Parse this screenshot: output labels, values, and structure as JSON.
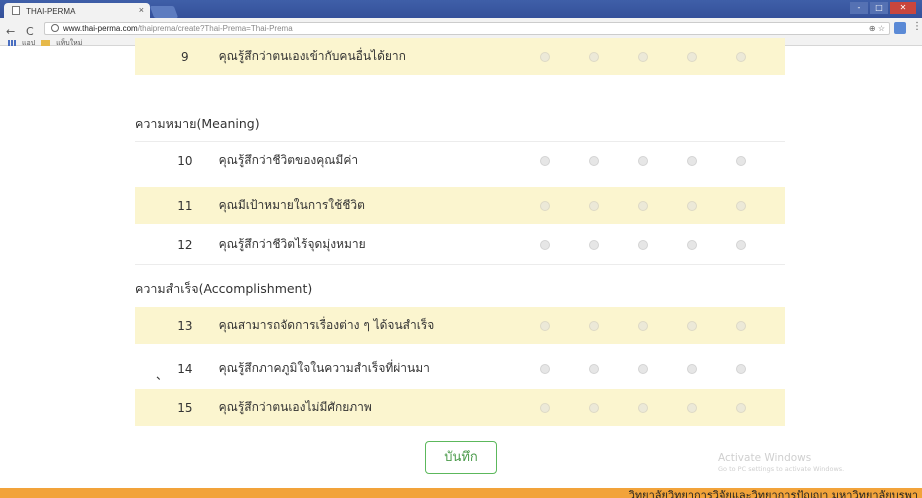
{
  "browser": {
    "tab_title": "THAI-PERMA",
    "tab_close": "×",
    "url_host": "www.thai-perma.com",
    "url_path": "/thaiprema/create?Thai-Prema=Thai-Prema",
    "bookmarks": [
      "แอป",
      "แท็บใหม่"
    ],
    "window_controls": [
      "-",
      "□",
      "✕"
    ]
  },
  "form": {
    "q9": {
      "num": "9",
      "text": "คุณรู้สึกว่าตนเองเข้ากับคนอื่นได้ยาก"
    },
    "section_meaning": "ความหมาย(Meaning)",
    "q10": {
      "num": "10",
      "text": "คุณรู้สึกว่าชีวิตของคุณมีค่า"
    },
    "q11": {
      "num": "11",
      "text": "คุณมีเป้าหมายในการใช้ชีวิต"
    },
    "q12": {
      "num": "12",
      "text": "คุณรู้สึกว่าชีวิตไร้จุดมุ่งหมาย"
    },
    "section_accomplishment": "ความสำเร็จ(Accomplishment)",
    "q13": {
      "num": "13",
      "text": "คุณสามารถจัดการเรื่องต่าง ๆ ได้จนสำเร็จ"
    },
    "q14": {
      "num": "14",
      "text": "คุณรู้สึกภาคภูมิใจในความสำเร็จที่ผ่านมา"
    },
    "q15": {
      "num": "15",
      "text": "คุณรู้สึกว่าตนเองไม่มีศักยภาพ"
    },
    "stray_mark": "、",
    "save_label": "บันทึก"
  },
  "watermark": {
    "line1": "Activate Windows",
    "line2": "Go to PC settings to activate Windows."
  },
  "footer": {
    "text": "วิทยาลัยวิทยาการวิจัยและวิทยาการปัญญา มหาวิทยาลัยบูรพา"
  },
  "colors": {
    "alt_row": "#fbf5cf",
    "footer": "#f2a33a",
    "save_border": "#5cb85c"
  }
}
